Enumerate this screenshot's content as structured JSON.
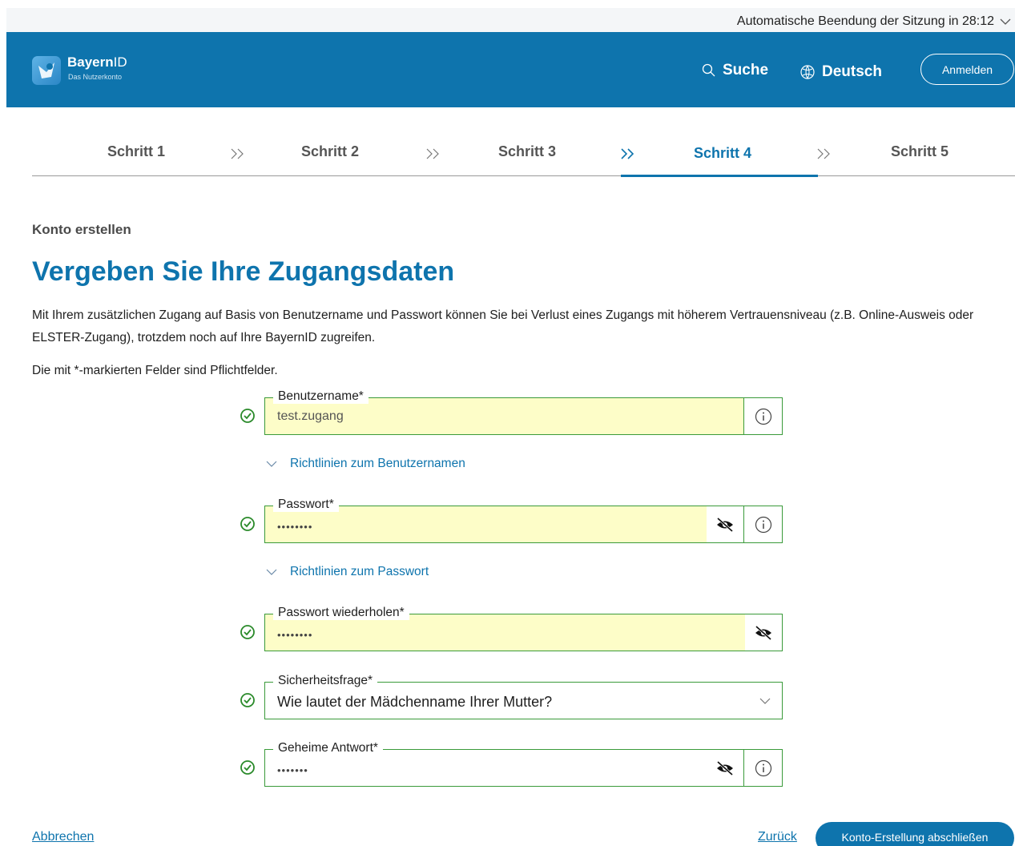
{
  "session": {
    "text": "Automatische Beendung der Sitzung in  28:12"
  },
  "header": {
    "logo_name_bold": "Bayern",
    "logo_name_light": "ID",
    "logo_sub": "Das Nutzerkonto",
    "search_label": "Suche",
    "language_label": "Deutsch",
    "login_label": "Anmelden"
  },
  "steps": [
    "Schritt 1",
    "Schritt 2",
    "Schritt 3",
    "Schritt 4",
    "Schritt 5"
  ],
  "active_step": "Schritt 4",
  "page": {
    "subtitle": "Konto erstellen",
    "title": "Vergeben Sie Ihre Zugangsdaten",
    "intro": "Mit Ihrem zusätzlichen Zugang auf Basis von Benutzername und Passwort können Sie bei Verlust eines Zugangs mit höherem Vertrauensniveau (z.B. Online-Ausweis oder ELSTER-Zugang), trotzdem noch auf Ihre BayernID zugreifen.",
    "required_note": "Die mit *-markierten Felder sind Pflichtfelder."
  },
  "form": {
    "username": {
      "label": "Benutzername*",
      "value": "test.zugang"
    },
    "username_guidelines": "Richtlinien zum Benutzernamen",
    "password": {
      "label": "Passwort*",
      "value": "••••••••"
    },
    "password_guidelines": "Richtlinien zum Passwort",
    "password_repeat": {
      "label": "Passwort wiederholen*",
      "value": "••••••••"
    },
    "security_question": {
      "label": "Sicherheitsfrage*",
      "value": "Wie lautet der Mädchenname Ihrer Mutter?"
    },
    "secret_answer": {
      "label": "Geheime Antwort*",
      "value": "•••••••"
    }
  },
  "actions": {
    "cancel": "Abbrechen",
    "back": "Zurück",
    "finish": "Konto-Erstellung abschließen"
  },
  "colors": {
    "brand": "#0e74ad",
    "valid": "#3a9a3a",
    "autofill": "#fdfdc8"
  }
}
